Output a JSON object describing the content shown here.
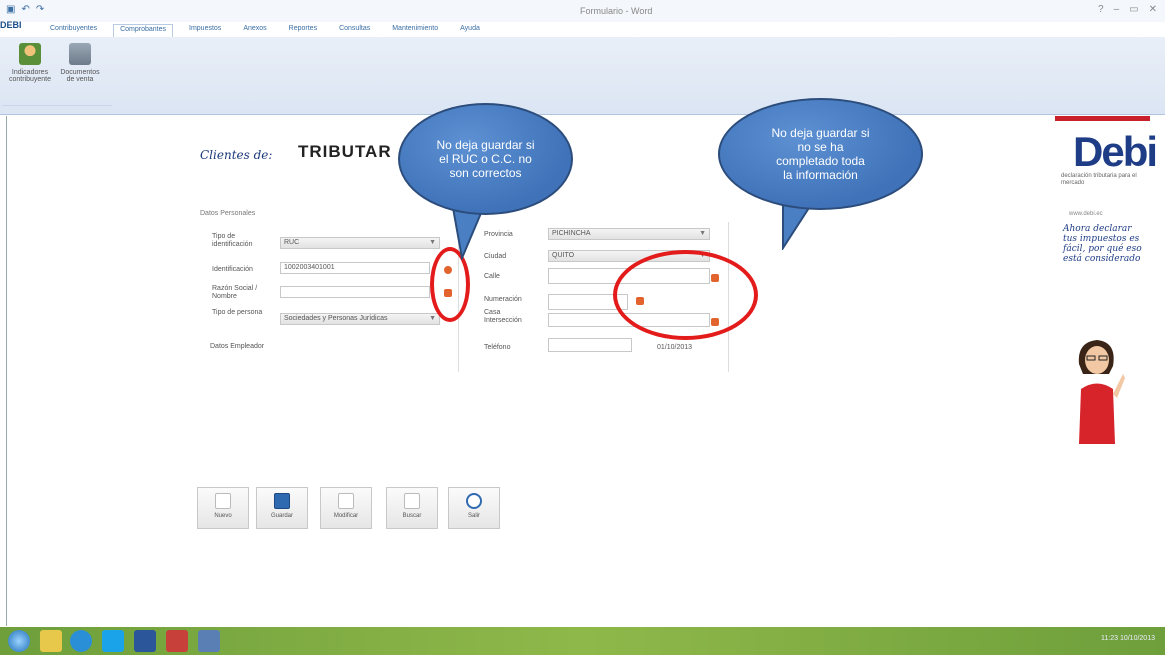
{
  "window": {
    "title": "Formulario - Word",
    "app_logo": "DEBI",
    "qat_icons": [
      "save-icon",
      "undo-icon",
      "redo-icon"
    ],
    "controls": [
      "?",
      "–",
      "▭",
      "✕"
    ]
  },
  "ribbon": {
    "tabs": [
      "Contribuyentes",
      "Comprobantes",
      "Impuestos",
      "Anexos",
      "Reportes",
      "Consultas",
      "Mantenimiento",
      "Ayuda"
    ],
    "active_tab_index": 1,
    "buttons": [
      {
        "label": "Indicadores contribuyente",
        "icon": "users-icon"
      },
      {
        "label": "Documentos de venta",
        "icon": "document-icon"
      }
    ]
  },
  "form": {
    "title_label": "Clientes de:",
    "title_main": "TRIBUTAR",
    "section_label": "Datos Personales",
    "left": {
      "tipo_ident_label": "Tipo de identificación",
      "tipo_ident_value": "RUC",
      "identificacion_label": "Identificación",
      "identificacion_value": "1002003401001",
      "razon_label": "Razón Social / Nombre",
      "razon_value": "",
      "tipo_persona_label": "Tipo de persona",
      "tipo_persona_value": "Sociedades y Personas Jurídicas",
      "datos_label": "Datos Empleador"
    },
    "right": {
      "provincia_label": "Provincia",
      "provincia_value": "PICHINCHA",
      "ciudad_label": "Ciudad",
      "ciudad_value": "QUITO",
      "calle_label": "Calle",
      "numeracion_label": "Numeración",
      "casa_label": "Casa Intersección",
      "telefono_label": "Teléfono",
      "fecha_value": "01/10/2013"
    }
  },
  "actions": [
    {
      "label": "Nuevo",
      "icon": "new-file-icon"
    },
    {
      "label": "Guardar",
      "icon": "save-icon"
    },
    {
      "label": "Modificar",
      "icon": "edit-icon"
    },
    {
      "label": "Buscar",
      "icon": "search-icon"
    },
    {
      "label": "Salir",
      "icon": "exit-icon"
    }
  ],
  "callouts": {
    "left": "No deja guardar si el RUC o C.C. no son correctos",
    "right": "No deja guardar si no se ha completado toda la información"
  },
  "ad": {
    "logo": "Debi",
    "subtitle": "declaración tributaria para el mercado",
    "link": "www.debi.ec",
    "note": "Ahora declarar tus impuestos es fácil, por qué eso está considerado"
  },
  "taskbar": {
    "clock": "11:23",
    "date": "10/10/2013"
  },
  "colors": {
    "bubble": "#4a7fc3",
    "ring": "#e31b1b",
    "taskbar": "#7aa83f",
    "ad_brand": "#1f3d86"
  }
}
